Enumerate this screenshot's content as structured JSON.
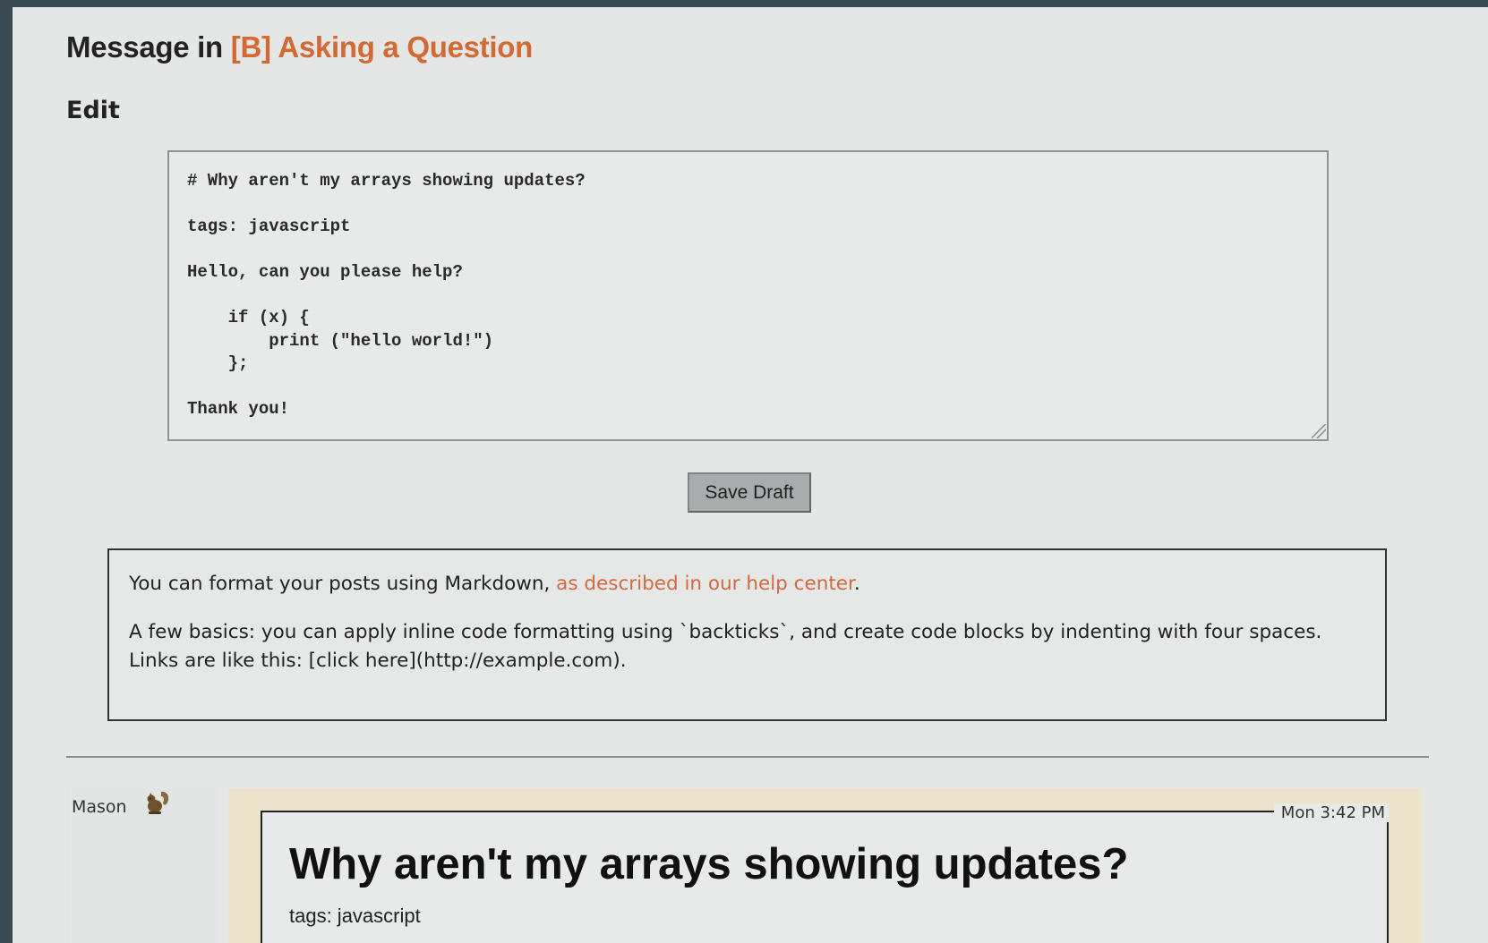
{
  "header": {
    "title_prefix": "Message in ",
    "board_link": "[B] Asking a Question",
    "section_heading": "Edit"
  },
  "editor": {
    "content": "# Why aren't my arrays showing updates?\n\ntags: javascript\n\nHello, can you please help?\n\n    if (x) {\n        print (\"hello world!\")\n    };\n\nThank you!"
  },
  "actions": {
    "save_draft_label": "Save Draft"
  },
  "help": {
    "line1_text": "You can format your posts using Markdown, ",
    "line1_link": "as described in our help center",
    "line1_end": ".",
    "line2": "A few basics: you can apply inline code formatting using `backticks`, and create code blocks by indenting with four spaces. Links are like this: [click here](http://example.com)."
  },
  "post": {
    "author": "Mason",
    "avatar_icon": "squirrel-icon",
    "timestamp": "Mon 3:42 PM",
    "heading": "Why aren't my arrays showing updates?",
    "tags": "tags: javascript"
  },
  "colors": {
    "accent": "#d46a33",
    "link": "#d26a40",
    "post_bg": "#ebe3cc"
  }
}
